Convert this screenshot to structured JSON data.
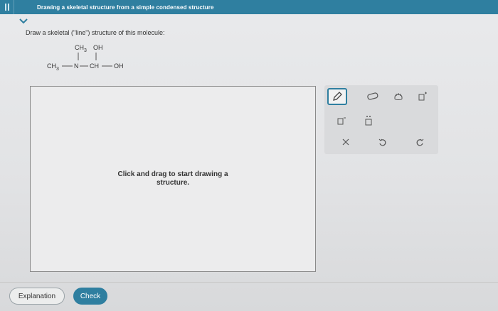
{
  "header": {
    "title": "Drawing a skeletal structure from a simple condensed structure",
    "menu_icon": "hamburger-icon"
  },
  "question": {
    "collapse_icon": "chevron-down-icon",
    "prompt": "Draw a skeletal (\"line\") structure of this molecule:",
    "molecule": {
      "ch3_top": "CH3",
      "oh_top": "OH",
      "ch3_left": "CH3",
      "n": "N",
      "ch": "CH",
      "oh_right": "OH"
    }
  },
  "canvas": {
    "hint": "Click and drag to start drawing a structure."
  },
  "toolbar": {
    "tools": [
      {
        "name": "pencil-icon",
        "active": true
      },
      {
        "name": "eraser-icon",
        "active": false
      },
      {
        "name": "hand-icon",
        "active": false
      },
      {
        "name": "positive-charge-icon",
        "active": false
      },
      {
        "name": "negative-charge-icon",
        "active": false
      },
      {
        "name": "lone-pair-icon",
        "active": false
      },
      {
        "name": "close-icon",
        "active": false
      },
      {
        "name": "undo-icon",
        "active": false
      },
      {
        "name": "redo-icon",
        "active": false
      }
    ],
    "accent": "#2f7fa0"
  },
  "footer": {
    "explanation_label": "Explanation",
    "check_label": "Check"
  }
}
